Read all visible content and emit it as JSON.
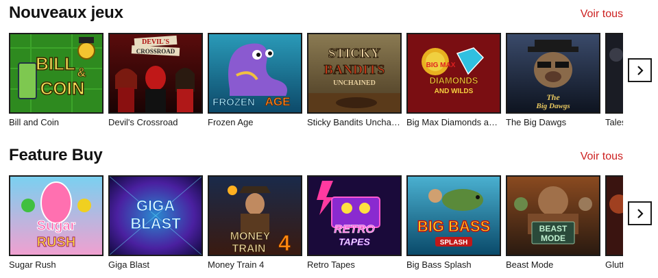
{
  "sections": [
    {
      "title": "Nouveaux jeux",
      "view_all": "Voir tous",
      "games": [
        {
          "name": "Bill and Coin"
        },
        {
          "name": "Devil's Crossroad"
        },
        {
          "name": "Frozen Age"
        },
        {
          "name": "Sticky Bandits Unchained"
        },
        {
          "name": "Big Max Diamonds and Wilds"
        },
        {
          "name": "The Big Dawgs"
        },
        {
          "name": "Tales"
        }
      ],
      "thumb_text": [
        "BILL",
        "&",
        "COIN",
        "DEVIL'S",
        "CROSSROAD",
        "FROZEN",
        "AGE",
        "STICKY",
        "BANDITS",
        "UNCHAINED",
        "BIG MAX",
        "DIAMONDS",
        "AND WILDS",
        "The",
        "Big Dawgs"
      ]
    },
    {
      "title": "Feature Buy",
      "view_all": "Voir tous",
      "games": [
        {
          "name": "Sugar Rush"
        },
        {
          "name": "Giga Blast"
        },
        {
          "name": "Money Train 4"
        },
        {
          "name": "Retro Tapes"
        },
        {
          "name": "Big Bass Splash"
        },
        {
          "name": "Beast Mode"
        },
        {
          "name": "Gluttony"
        }
      ],
      "thumb_text": [
        "Sugar",
        "RUSH",
        "GIGA",
        "BLAST",
        "MONEY",
        "TRAIN",
        "4",
        "RETRO",
        "TAPES",
        "BIG BASS",
        "SPLASH",
        "BEAST",
        "MODE"
      ]
    }
  ],
  "colors": {
    "accent": "#cc1f1f",
    "text": "#111111",
    "border": "#1a1a1a"
  },
  "icons": {
    "next": "chevron-right-icon"
  }
}
